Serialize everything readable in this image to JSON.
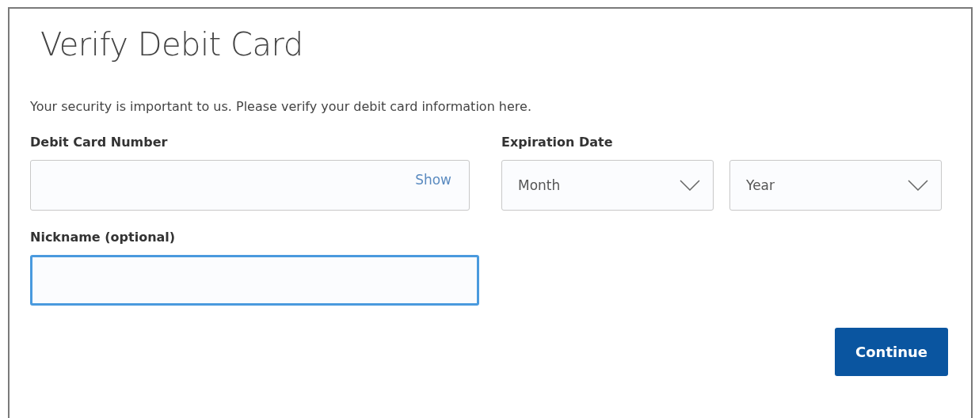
{
  "title": "Verify Debit Card",
  "description": "Your security is important to us. Please verify your debit card information here.",
  "card_number": {
    "label": "Debit Card Number",
    "toggle": "Show"
  },
  "expiration": {
    "label": "Expiration Date",
    "selects": [
      {
        "placeholder": "Month"
      },
      {
        "placeholder": "Year"
      }
    ]
  },
  "nickname": {
    "label": "Nickname (optional)",
    "focused": true
  },
  "buttons": [
    {
      "label": "Continue",
      "kind": "primary"
    }
  ]
}
